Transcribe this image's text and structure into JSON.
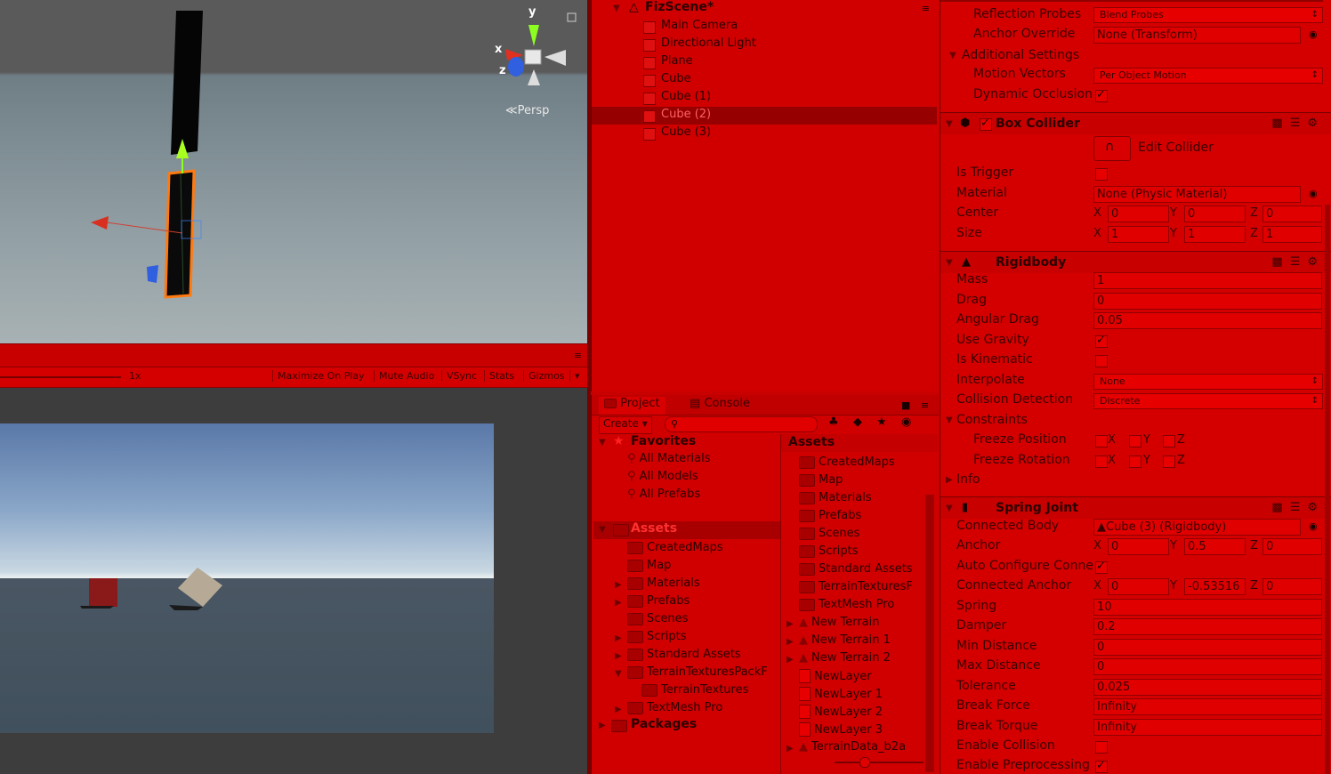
{
  "scene": {
    "persp_label": "Persp",
    "gizmo": {
      "x": "x",
      "y": "y",
      "z": "z"
    }
  },
  "game_toolbar": {
    "scale": "1x",
    "maximize": "Maximize On Play",
    "mute": "Mute Audio",
    "vsync": "VSync",
    "stats": "Stats",
    "gizmos": "Gizmos"
  },
  "hierarchy": {
    "scene_name": "FizScene*",
    "items": [
      "Main Camera",
      "Directional Light",
      "Plane",
      "Cube",
      "Cube (1)",
      "Cube (2)",
      "Cube (3)"
    ],
    "selected": "Cube (2)"
  },
  "project": {
    "tabs": {
      "project": "Project",
      "console": "Console"
    },
    "create": "Create",
    "favorites": {
      "title": "Favorites",
      "items": [
        "All Materials",
        "All Models",
        "All Prefabs"
      ]
    },
    "tree": {
      "assets": "Assets",
      "items": [
        "CreatedMaps",
        "Map",
        "Materials",
        "Prefabs",
        "Scenes",
        "Scripts",
        "Standard Assets",
        "TerrainTexturesPackF",
        "TerrainTextures",
        "TextMesh Pro"
      ],
      "packages": "Packages"
    },
    "assets_panel": {
      "title": "Assets",
      "items": [
        "CreatedMaps",
        "Map",
        "Materials",
        "Prefabs",
        "Scenes",
        "Scripts",
        "Standard Assets",
        "TerrainTexturesF",
        "TextMesh Pro",
        "New Terrain",
        "New Terrain 1",
        "New Terrain 2",
        "NewLayer",
        "NewLayer 1",
        "NewLayer 2",
        "NewLayer 3",
        "TerrainData_b2a"
      ]
    }
  },
  "inspector": {
    "mesh_renderer": {
      "reflection_probes_label": "Reflection Probes",
      "reflection_probes_value": "Blend Probes",
      "anchor_override_label": "Anchor Override",
      "anchor_override_value": "None (Transform)",
      "additional_settings": "Additional Settings",
      "motion_vectors_label": "Motion Vectors",
      "motion_vectors_value": "Per Object Motion",
      "dynamic_occlusion_label": "Dynamic Occlusion"
    },
    "box_collider": {
      "title": "Box Collider",
      "edit_collider": "Edit Collider",
      "is_trigger": "Is Trigger",
      "material_label": "Material",
      "material_value": "None (Physic Material)",
      "center_label": "Center",
      "center": {
        "x": "0",
        "y": "0",
        "z": "0"
      },
      "size_label": "Size",
      "size": {
        "x": "1",
        "y": "1",
        "z": "1"
      }
    },
    "rigidbody": {
      "title": "Rigidbody",
      "mass_label": "Mass",
      "mass": "1",
      "drag_label": "Drag",
      "drag": "0",
      "angular_drag_label": "Angular Drag",
      "angular_drag": "0.05",
      "use_gravity": "Use Gravity",
      "is_kinematic": "Is Kinematic",
      "interpolate_label": "Interpolate",
      "interpolate": "None",
      "collision_detection_label": "Collision Detection",
      "collision_detection": "Discrete",
      "constraints": "Constraints",
      "freeze_position": "Freeze Position",
      "freeze_rotation": "Freeze Rotation",
      "info": "Info"
    },
    "spring_joint": {
      "title": "Spring Joint",
      "connected_body_label": "Connected Body",
      "connected_body": "Cube (3) (Rigidbody)",
      "anchor_label": "Anchor",
      "anchor": {
        "x": "0",
        "y": "0.5",
        "z": "0"
      },
      "auto_configure": "Auto Configure Conne",
      "connected_anchor_label": "Connected Anchor",
      "connected_anchor": {
        "x": "0",
        "y": "-0.53516",
        "z": "0"
      },
      "spring_label": "Spring",
      "spring": "10",
      "damper_label": "Damper",
      "damper": "0.2",
      "min_distance_label": "Min Distance",
      "min_distance": "0",
      "max_distance_label": "Max Distance",
      "max_distance": "0",
      "tolerance_label": "Tolerance",
      "tolerance": "0.025",
      "break_force_label": "Break Force",
      "break_force": "Infinity",
      "break_torque_label": "Break Torque",
      "break_torque": "Infinity",
      "enable_collision": "Enable Collision",
      "enable_preprocessing": "Enable Preprocessing"
    }
  }
}
